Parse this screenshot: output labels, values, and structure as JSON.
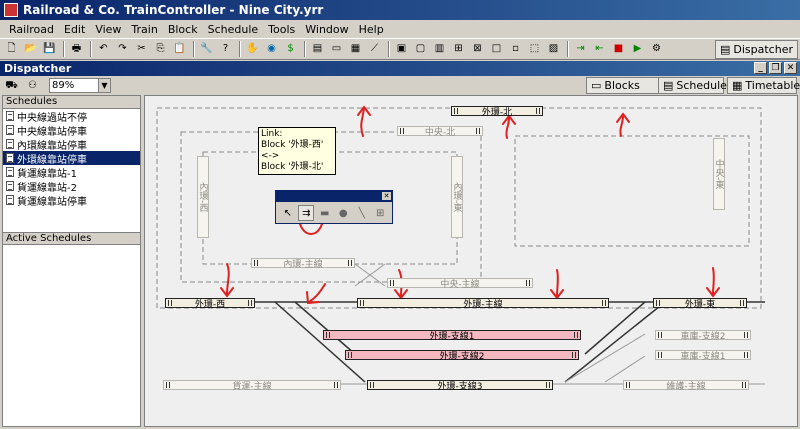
{
  "app": {
    "title": "Railroad & Co. TrainController - Nine City.yrr"
  },
  "menu": [
    "Railroad",
    "Edit",
    "View",
    "Train",
    "Block",
    "Schedule",
    "Tools",
    "Window",
    "Help"
  ],
  "toolbar": {
    "dispatcher_label": "Dispatcher"
  },
  "dispatcher": {
    "title": "Dispatcher",
    "zoom": "89%",
    "tabs": {
      "blocks": "Blocks",
      "schedules": "Schedules",
      "timetables": "Timetables"
    }
  },
  "schedules": {
    "header": "Schedules",
    "items": [
      "中央線過站不停",
      "中央線靠站停車",
      "內環線靠站停車",
      "外環線靠站停車",
      "貨運線靠站-1",
      "貨運線靠站-2",
      "貨運線靠站停車"
    ],
    "selected_index": 3
  },
  "active_schedules": {
    "header": "Active Schedules"
  },
  "tooltip": {
    "line1": "Link:",
    "line2": "Block '外環-西'",
    "line3": "<->",
    "line4": "Block '外環-北'"
  },
  "blocks": {
    "outer_north": "外環-北",
    "central_north": "中央-北",
    "inner_west": "內環-西",
    "inner_east": "內環-東",
    "central_east": "中央-東",
    "inner_main": "內環-主線",
    "central_main": "中央-主線",
    "outer_west": "外環-西",
    "outer_main": "外環-主線",
    "outer_east": "外環-東",
    "outer_branch1": "外環-支線1",
    "outer_branch2": "外環-支線2",
    "outer_branch3": "外環-支線3",
    "vehicle_branch2": "車庫-支線2",
    "vehicle_branch1": "車庫-支線1",
    "freight_main": "貨運-主線",
    "maintenance_main": "維護-主線"
  },
  "colors": {
    "title_bar": "#0a246a",
    "occupied_block": "#f3b8c0",
    "annotation": "#e02020",
    "selected": "#0a246a"
  }
}
